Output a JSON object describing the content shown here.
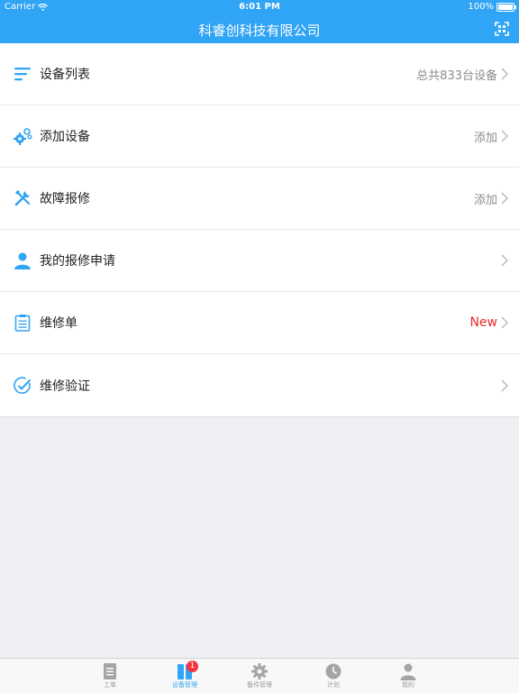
{
  "status_bar": {
    "carrier": "Carrier",
    "time": "6:01 PM",
    "battery": "100%"
  },
  "nav": {
    "title": "科睿创科技有限公司",
    "scan_icon": "scan-icon"
  },
  "menu": [
    {
      "label": "设备列表",
      "detail": "总共833台设备",
      "icon": "list-icon"
    },
    {
      "label": "添加设备",
      "detail": "添加",
      "icon": "gears-icon"
    },
    {
      "label": "故障报修",
      "detail": "添加",
      "icon": "tools-icon"
    },
    {
      "label": "我的报修申请",
      "detail": "",
      "icon": "user-icon"
    },
    {
      "label": "维修单",
      "detail": "New",
      "icon": "clipboard-icon"
    },
    {
      "label": "维修验证",
      "detail": "",
      "icon": "check-circle-icon"
    }
  ],
  "tabs": [
    {
      "label": "工单",
      "icon": "document-icon"
    },
    {
      "label": "设备管理",
      "icon": "device-icon",
      "badge": "1",
      "active": true
    },
    {
      "label": "备件管理",
      "icon": "gear-icon"
    },
    {
      "label": "计划",
      "icon": "clock-icon"
    },
    {
      "label": "我的",
      "icon": "user-icon"
    }
  ],
  "colors": {
    "accent": "#30a4f5",
    "new": "#e8282d",
    "badge": "#f4333c",
    "background": "#eff0f4"
  }
}
